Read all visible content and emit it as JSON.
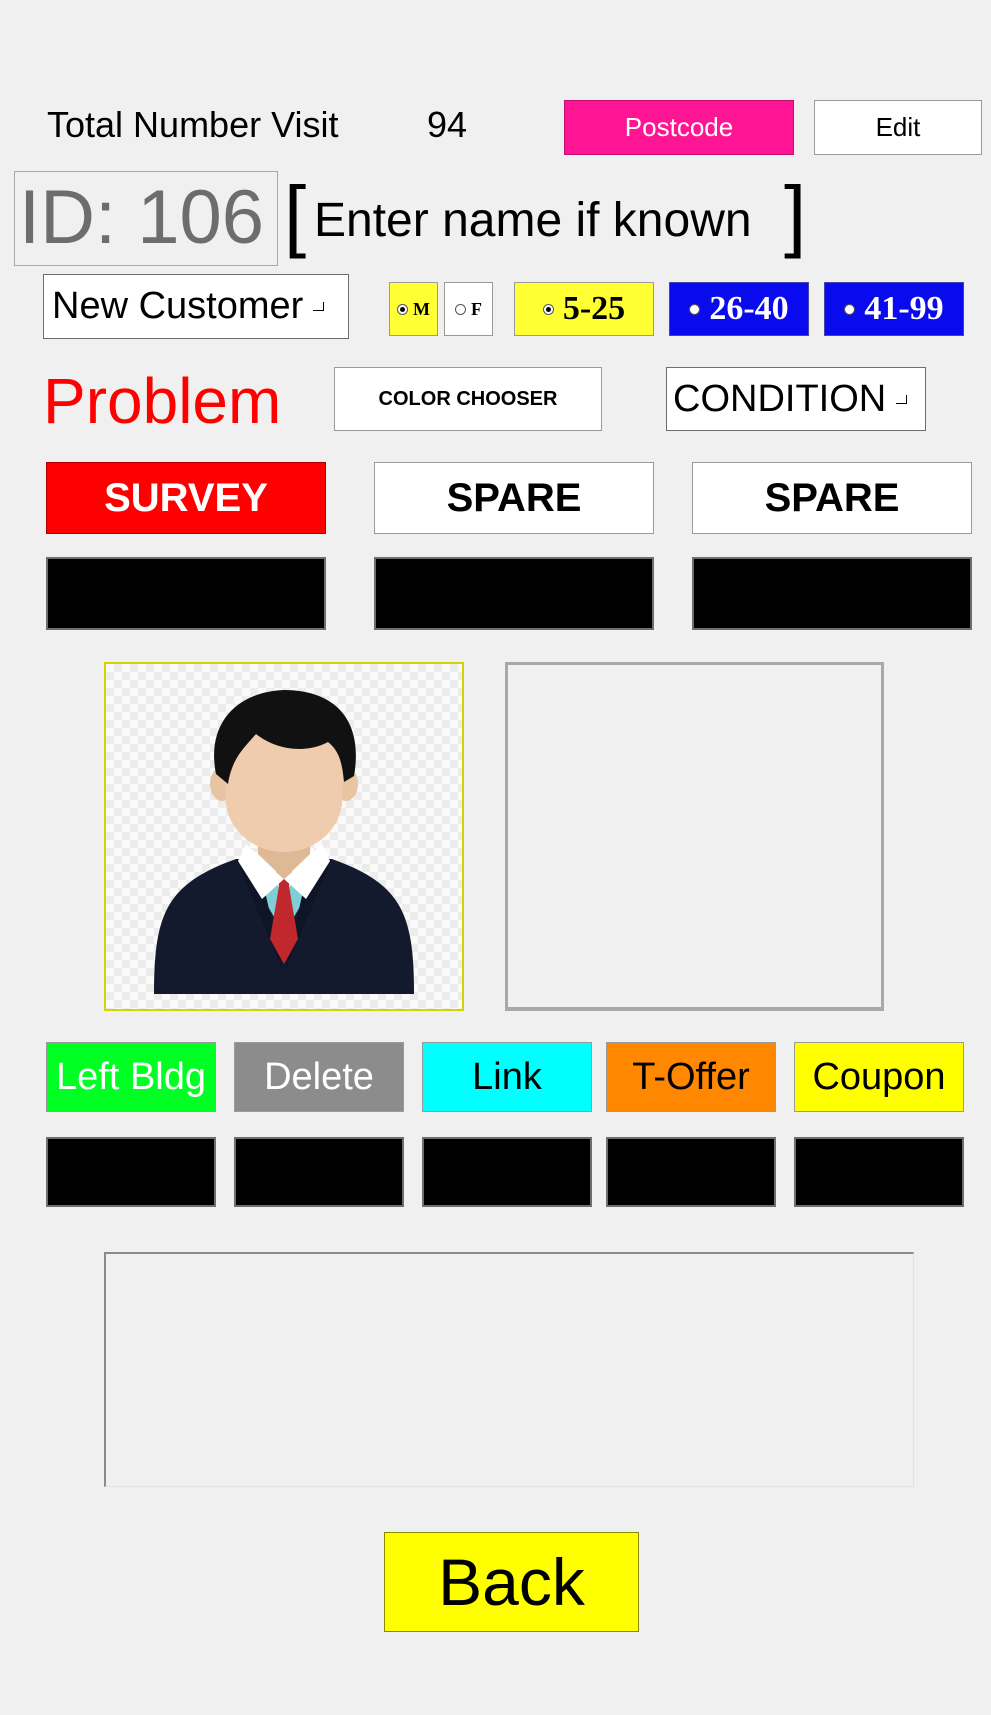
{
  "header": {
    "visits_label": "Total Number Visit",
    "visits_count": "94",
    "postcode_label": "Postcode",
    "edit_label": "Edit"
  },
  "customer": {
    "id_text": "ID: 106",
    "bracket_open": "[",
    "bracket_close": "]",
    "name_value": "Enter name if known",
    "status_value": "New Customer"
  },
  "gender": {
    "options": [
      "M",
      "F"
    ],
    "selected": "M"
  },
  "age_groups": {
    "options": [
      "5-25",
      "26-40",
      "41-99"
    ],
    "selected": "5-25",
    "colors": [
      "#ffff33",
      "#0a0aee",
      "#0a0aee"
    ]
  },
  "problem": {
    "label": "Problem",
    "color_chooser_label": "COLOR CHOOSER",
    "condition_value": "CONDITION"
  },
  "action_buttons": {
    "survey": "SURVEY",
    "spare_1": "SPARE",
    "spare_2": "SPARE"
  },
  "bottom_buttons": {
    "left_bldg": "Left Bldg",
    "delete": "Delete",
    "link": "Link",
    "t_offer": "T-Offer",
    "coupon": "Coupon"
  },
  "footer": {
    "back_label": "Back"
  },
  "colors": {
    "background": "#f0f0f0",
    "postcode": "#ff1493",
    "survey": "#ff0000",
    "problem_text": "#ff0000",
    "yellow": "#ffff00",
    "left_bldg": "#00ff22",
    "delete": "#8c8c8c",
    "link": "#00ffff",
    "t_offer": "#ff8800",
    "coupon": "#ffff00"
  },
  "icons": {
    "avatar": "businessman-avatar-icon"
  }
}
